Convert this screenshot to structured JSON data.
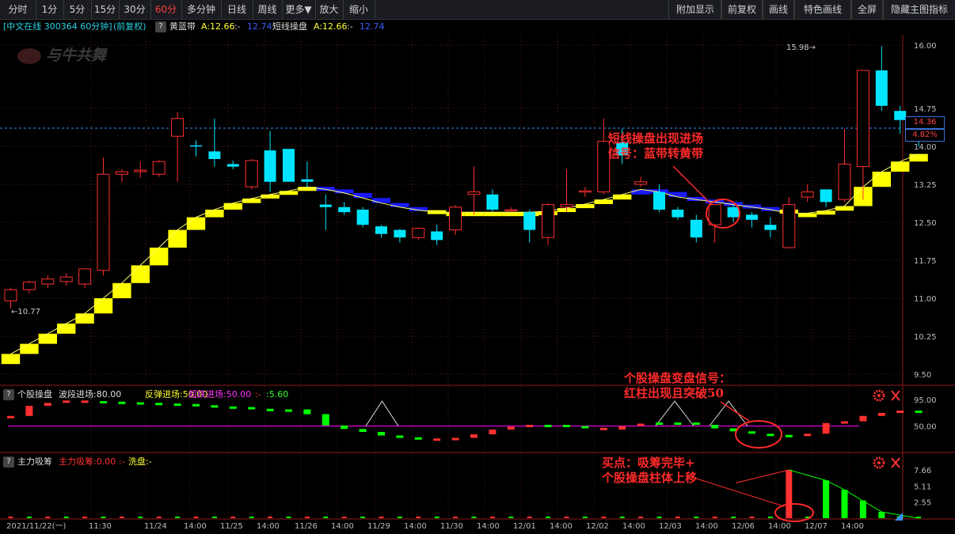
{
  "toolbar": {
    "left": [
      "分时",
      "1分",
      "5分",
      "15分",
      "30分",
      "60分",
      "多分钟",
      "日线",
      "周线",
      "更多▼",
      "放大",
      "缩小"
    ],
    "active_index": 5,
    "right": [
      "附加显示",
      "前复权",
      "画线",
      "特色画线",
      "全屏",
      "隐藏主图指标"
    ]
  },
  "infobar": {
    "stock": "[中文在线 300364 60分钟]",
    "adjust": "(前复权)",
    "q": "?",
    "ind1_name": "黄蓝带",
    "ind1_a": "A:12.66",
    "ind1_b": ":-",
    "ind1_c": "12.74",
    "ind2_name": "短线操盘",
    "ind2_a": "A:12.66",
    "ind2_b": ":-",
    "ind2_c": "12.74"
  },
  "logo": "与牛共舞",
  "main_axis": [
    "16.00",
    "14.75",
    "14.00",
    "13.25",
    "12.50",
    "11.75",
    "11.00",
    "10.25",
    "9.50"
  ],
  "high_label": "15.98",
  "low_label": "10.77",
  "price_tag": "14.36",
  "pct_tag": "4.82%",
  "sub1": {
    "q": "?",
    "name": "个股操盘",
    "a": "波段进场:80.00",
    "b": "反弹进场:50.00",
    "c": "超跌进场:50.00",
    "d": ":-",
    "e": ":5.60",
    "axis": [
      "95.00",
      "50.00"
    ]
  },
  "sub2": {
    "q": "?",
    "name": "主力吸筹",
    "a": "主力吸筹:0.00",
    "b": ":-",
    "c": "洗盘:-",
    "axis": [
      "7.66",
      "5.11",
      "2.55"
    ]
  },
  "time_axis": [
    "2021/11/22(一)",
    "11:30",
    "11/24",
    "14:00",
    "11/25",
    "14:00",
    "11/26",
    "14:00",
    "11/29",
    "14:00",
    "11/30",
    "14:00",
    "12/01",
    "14:00",
    "12/02",
    "14:00",
    "12/03",
    "14:00",
    "12/06",
    "14:00",
    "12/07",
    "14:00"
  ],
  "annotations": {
    "a1_l1": "短线操盘出现进场",
    "a1_l2": "信号：蓝带转黄带",
    "a2_l1": "个股操盘变盘信号：",
    "a2_l2": "红柱出现且突破50",
    "a3_l1": "买点：吸筹完毕+",
    "a3_l2": "个股操盘柱体上移"
  },
  "colors": {
    "up": "#ff3030",
    "down": "#00e5ff",
    "yellow": "#ffff00",
    "blue": "#1a1aff",
    "green": "#00ff00",
    "magenta": "#ff00ff"
  },
  "chart_data": {
    "type": "candlestick",
    "candles": [
      [
        10.95,
        11.17,
        11.21,
        10.8
      ],
      [
        11.17,
        11.32,
        11.35,
        11.1
      ],
      [
        11.28,
        11.38,
        11.45,
        11.2
      ],
      [
        11.33,
        11.42,
        11.5,
        11.25
      ],
      [
        11.28,
        11.58,
        11.58,
        11.2
      ],
      [
        11.55,
        13.45,
        13.78,
        11.45
      ],
      [
        13.45,
        13.5,
        13.55,
        13.3
      ],
      [
        13.5,
        13.53,
        13.7,
        13.38
      ],
      [
        13.45,
        13.7,
        13.73,
        13.4
      ],
      [
        14.2,
        14.55,
        14.68,
        13.3
      ],
      [
        14.02,
        14.0,
        14.12,
        13.8
      ],
      [
        13.9,
        13.75,
        14.55,
        13.6
      ],
      [
        13.65,
        13.6,
        13.72,
        13.55
      ],
      [
        13.2,
        13.72,
        13.75,
        13.15
      ],
      [
        13.92,
        13.3,
        14.3,
        13.1
      ],
      [
        13.95,
        13.3,
        13.95,
        13.3
      ],
      [
        13.35,
        13.3,
        13.7,
        13.2
      ],
      [
        12.85,
        12.8,
        13.05,
        12.35
      ],
      [
        12.8,
        12.7,
        12.9,
        12.65
      ],
      [
        12.75,
        12.45,
        12.8,
        12.4
      ],
      [
        12.42,
        12.27,
        12.45,
        12.2
      ],
      [
        12.35,
        12.2,
        12.37,
        12.1
      ],
      [
        12.2,
        12.38,
        12.4,
        12.15
      ],
      [
        12.32,
        12.15,
        12.45,
        12.05
      ],
      [
        12.35,
        12.8,
        12.84,
        12.25
      ],
      [
        13.05,
        13.1,
        13.6,
        12.65
      ],
      [
        13.05,
        12.75,
        13.15,
        12.7
      ],
      [
        12.75,
        12.75,
        12.8,
        12.7
      ],
      [
        12.7,
        12.35,
        12.75,
        12.1
      ],
      [
        12.2,
        12.85,
        12.88,
        12.05
      ],
      [
        12.8,
        12.85,
        13.55,
        12.7
      ],
      [
        13.1,
        13.12,
        13.2,
        13.0
      ],
      [
        13.1,
        14.1,
        14.55,
        13.05
      ],
      [
        14.08,
        13.82,
        14.35,
        13.65
      ],
      [
        13.25,
        13.3,
        13.4,
        13.2
      ],
      [
        13.1,
        12.75,
        13.25,
        12.7
      ],
      [
        12.75,
        12.6,
        12.8,
        12.55
      ],
      [
        12.55,
        12.2,
        12.65,
        12.1
      ],
      [
        12.45,
        12.85,
        12.85,
        12.1
      ],
      [
        12.8,
        12.6,
        12.85,
        12.5
      ],
      [
        12.65,
        12.55,
        12.7,
        12.4
      ],
      [
        12.45,
        12.35,
        12.6,
        12.2
      ],
      [
        12.0,
        12.85,
        13.0,
        11.98
      ],
      [
        13.0,
        13.1,
        13.25,
        12.9
      ],
      [
        13.15,
        12.9,
        13.15,
        12.8
      ],
      [
        12.95,
        13.65,
        14.35,
        12.9
      ],
      [
        13.6,
        15.5,
        15.5,
        12.95
      ],
      [
        15.5,
        14.8,
        15.98,
        14.7
      ],
      [
        14.7,
        14.52,
        14.8,
        14.25
      ],
      [
        14.5,
        14.36,
        14.6,
        14.0
      ]
    ],
    "yellow_band": [
      9.9,
      10.1,
      10.3,
      10.5,
      10.7,
      11.0,
      11.3,
      11.65,
      12.0,
      12.35,
      12.6,
      12.75,
      12.88,
      12.97,
      13.05,
      13.12,
      13.2,
      13.15,
      13.08,
      12.98,
      12.88,
      12.8,
      12.74,
      12.7,
      12.7,
      12.7,
      12.7,
      12.7,
      12.7,
      12.72,
      12.78,
      12.86,
      12.95,
      13.05,
      13.15,
      13.1,
      13.0,
      12.95,
      12.9,
      12.85,
      12.8,
      12.75,
      12.68,
      12.68,
      12.73,
      12.82,
      13.2,
      13.5,
      13.7,
      13.85
    ],
    "blue_from": 17,
    "blue_to": 22,
    "blue_from2": 34,
    "blue_to2": 41,
    "sub1_values": [
      67,
      84,
      89,
      93,
      92,
      91,
      90,
      89,
      88,
      87,
      85,
      83,
      82,
      79,
      77,
      78,
      70,
      51,
      45,
      40,
      34,
      31,
      29,
      28,
      30,
      36,
      44,
      49,
      52,
      52,
      50,
      47,
      44,
      50,
      54,
      56,
      56,
      52,
      46,
      41,
      37,
      35,
      35,
      37,
      55,
      58,
      67,
      72,
      76,
      75
    ],
    "sub1_up": [
      true,
      true,
      true,
      true,
      true,
      false,
      false,
      false,
      false,
      false,
      false,
      false,
      false,
      false,
      false,
      false,
      false,
      false,
      false,
      false,
      false,
      false,
      false,
      true,
      true,
      true,
      true,
      true,
      true,
      false,
      false,
      false,
      true,
      true,
      true,
      false,
      false,
      false,
      false,
      false,
      false,
      false,
      false,
      true,
      true,
      true,
      true,
      true,
      true,
      false
    ],
    "sub2_values": [
      0,
      0,
      0,
      0,
      0,
      0,
      0,
      0,
      0,
      0,
      0,
      0,
      0,
      0,
      0,
      0,
      0,
      0,
      0,
      0,
      0,
      0,
      0,
      0,
      0,
      0,
      0,
      0,
      0,
      0,
      0,
      0,
      0,
      0,
      0,
      0,
      0,
      0,
      0,
      0,
      0,
      0,
      7.66,
      0,
      6.0,
      4.5,
      2.8,
      1.0,
      0.3,
      0
    ]
  }
}
